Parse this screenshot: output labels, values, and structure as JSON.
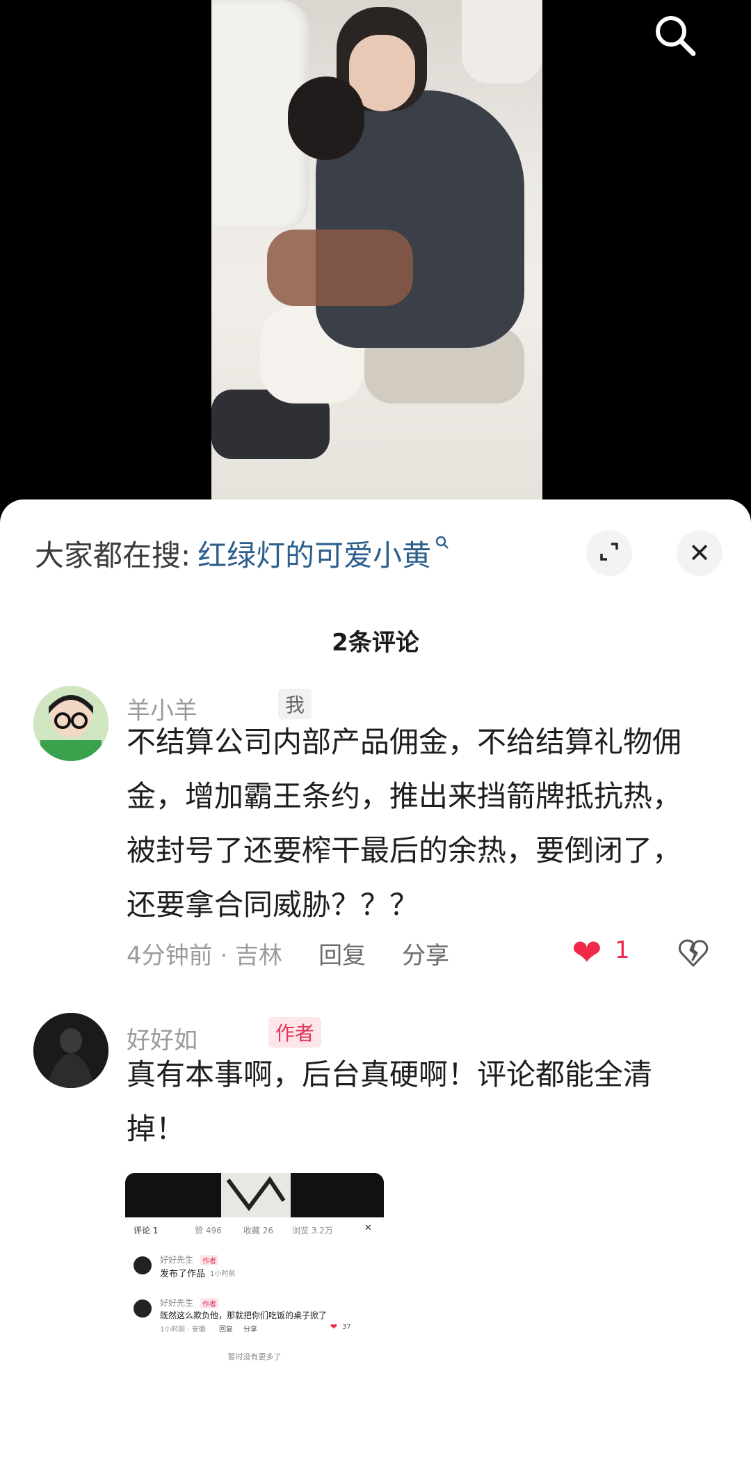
{
  "top": {
    "search_icon": "search-icon"
  },
  "sheet": {
    "suggest_prefix": "大家都在搜:",
    "suggest_link": "红绿灯的可爱小黄",
    "suggest_icon": "search-small-icon",
    "expand_icon": "expand-icon",
    "close_symbol": "✕",
    "count_label": "2条评论"
  },
  "comments": [
    {
      "name": "羊小羊",
      "tag": "我",
      "text": "不结算公司内部产品佣金，不给结算礼物佣金，增加霸王条约，推出来挡箭牌抵抗热，被封号了还要榨干最后的余热，要倒闭了，还要拿合同威胁？？？",
      "time_location": "4分钟前 · 吉林",
      "reply_label": "回复",
      "share_label": "分享",
      "like_symbol": "❤",
      "like_count": "1"
    },
    {
      "name": "好好如",
      "tag": "作者",
      "text": "真有本事啊，后台真硬啊！评论都能全清掉！"
    }
  ],
  "embedded_screenshot": {
    "tabs": [
      "评论 1",
      "赞 496",
      "收藏 26",
      "浏览 3.2万"
    ],
    "items": [
      {
        "name": "好好先生",
        "tag": "作者",
        "text": "发布了作品",
        "time": "1小时前"
      },
      {
        "name": "好好先生",
        "tag": "作者",
        "text": "既然这么欺负他，那就把你们吃饭的桌子掀了",
        "meta": "1小时前 · 安徽",
        "reply": "回复",
        "share": "分享",
        "likes": "37"
      }
    ],
    "footer": "暂时没有更多了"
  },
  "colors": {
    "link": "#2d5f8d",
    "like": "#f0284a",
    "author_tag_bg": "#fde6ea",
    "author_tag_text": "#e0345a"
  }
}
